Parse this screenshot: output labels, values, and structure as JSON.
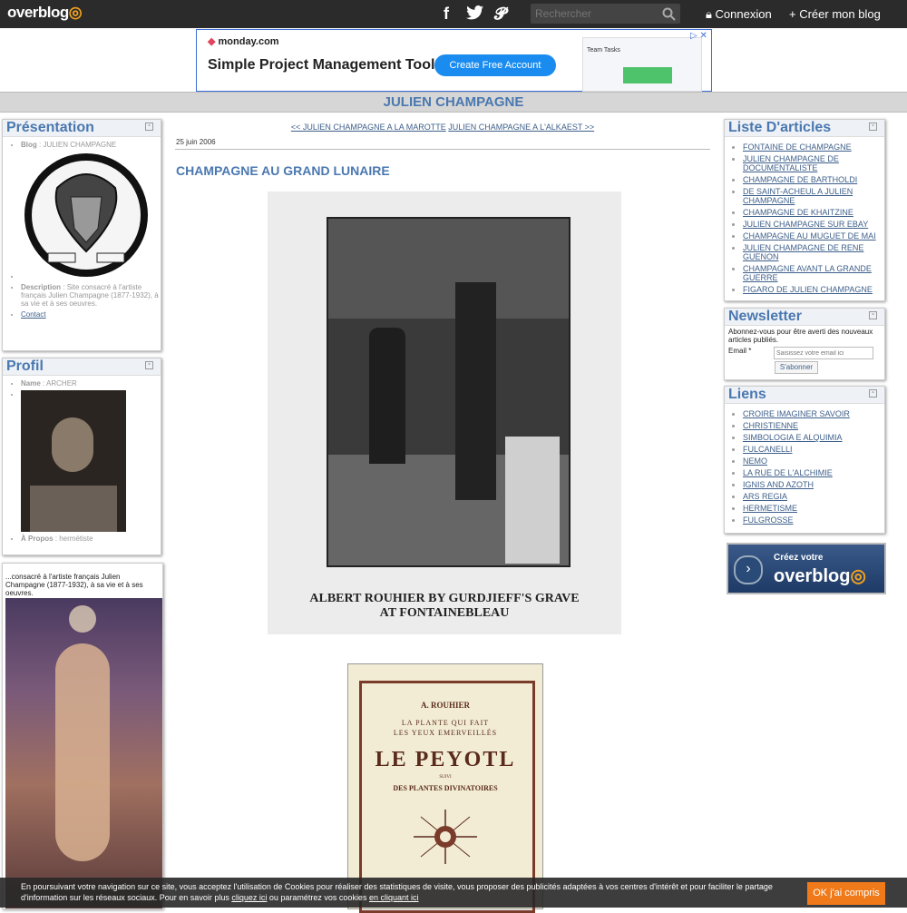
{
  "topbar": {
    "logo": "overblog",
    "search_placeholder": "Rechercher",
    "connexion": "Connexion",
    "creer": "Créer mon blog"
  },
  "ad": {
    "brand": "monday.com",
    "title": "Simple Project Management Tool",
    "button": "Create Free Account",
    "mock_title": "Team Tasks"
  },
  "blog": {
    "title": "JULIEN CHAMPAGNE"
  },
  "presentation": {
    "title": "Présentation",
    "blog_label": "Blog",
    "blog_value": "JULIEN CHAMPAGNE",
    "description_label": "Description",
    "description_value": "Site consacré à l'artiste français Julien Champagne (1877-1932), à sa vie et à ses oeuvres.",
    "contact": "Contact"
  },
  "profil": {
    "title": "Profil",
    "name_label": "Name",
    "name_value": "ARCHER",
    "apropos_label": "À Propos",
    "apropos_value": "hermétiste"
  },
  "side_text": "...consacré à l'artiste français Julien Champagne (1877-1932), à sa vie et à ses oeuvres.",
  "article": {
    "prev_link": "<< JULIEN CHAMPAGNE A LA MAROTTE",
    "next_link": "JULIEN CHAMPAGNE A L'ALKAEST >>",
    "date": "25 juin 2006",
    "title": "CHAMPAGNE AU GRAND LUNAIRE",
    "caption_line1": "ALBERT ROUHIER BY GURDJIEFF'S GRAVE",
    "caption_line2": "AT FONTAINEBLEAU",
    "book_author": "A. ROUHIER",
    "book_sub1": "LA PLANTE QUI FAIT",
    "book_sub2": "LES YEUX EMERVEILLÉS",
    "book_title": "LE PEYOTL",
    "book_suivi": "SUIVI",
    "book_sub3": "DES PLANTES DIVINATOIRES"
  },
  "articles_list": {
    "title": "Liste D'articles",
    "items": [
      "FONTAINE DE CHAMPAGNE",
      "JULIEN CHAMPAGNE DE DOCUMENTALISTE",
      "CHAMPAGNE DE BARTHOLDI",
      "DE SAINT-ACHEUL A JULIEN CHAMPAGNE",
      "CHAMPAGNE DE KHAITZINE",
      "JULIEN CHAMPAGNE SUR EBAY",
      "CHAMPAGNE AU MUGUET DE MAI",
      "JULIEN CHAMPAGNE DE RENE GUENON",
      "CHAMPAGNE AVANT LA GRANDE GUERRE",
      "FIGARO DE JULIEN CHAMPAGNE"
    ]
  },
  "newsletter": {
    "title": "Newsletter",
    "text": "Abonnez-vous pour être averti des nouveaux articles publiés.",
    "email_label": "Email *",
    "email_placeholder": "Saisissez votre email ici",
    "subscribe": "S'abonner"
  },
  "liens": {
    "title": "Liens",
    "items": [
      "CROIRE IMAGINER SAVOIR",
      "CHRISTIENNE",
      "SIMBOLOGIA E ALQUIMIA",
      "FULCANELLI",
      "NEMO",
      "LA RUE DE L'ALCHIMIE",
      "IGNIS AND AZOTH",
      "ARS REGIA",
      "HERMETISME",
      "FULGROSSE"
    ]
  },
  "promo": {
    "line1": "Créez votre",
    "line2": "overblog"
  },
  "cookie": {
    "text": "En poursuivant votre navigation sur ce site, vous acceptez l'utilisation de Cookies pour réaliser des statistiques de visite, vous proposer des publicités adaptées à vos centres d'intérêt et pour faciliter le partage d'information sur les réseaux sociaux. Pour en savoir plus",
    "link1": "cliquez ici",
    "mid": "ou paramétrez vos cookies",
    "link2": "en cliquant ici",
    "ok": "OK j'ai compris"
  }
}
